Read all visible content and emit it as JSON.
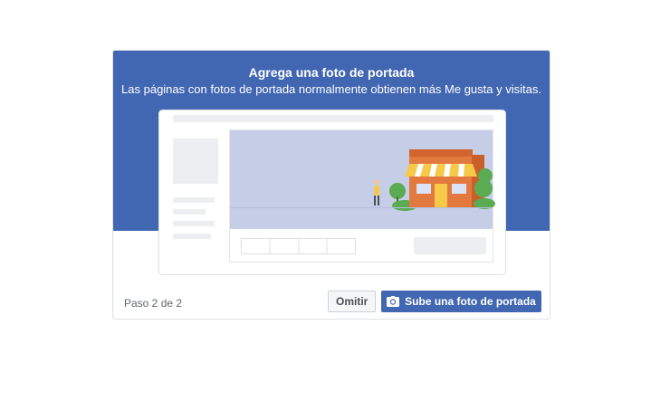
{
  "dialog": {
    "title": "Agrega una foto de portada",
    "subtitle": "Las páginas con fotos de portada normalmente obtienen más Me gusta y visitas.",
    "step": "Paso 2 de 2",
    "skip_label": "Omitir",
    "upload_label": "Sube una foto de portada",
    "upload_icon": "camera-icon"
  },
  "colors": {
    "brand": "#4267b2",
    "cover_area": "#c5cee6",
    "store_wall": "#e27a3f",
    "awning_yellow": "#f7c948",
    "tree_green": "#5aab52"
  }
}
